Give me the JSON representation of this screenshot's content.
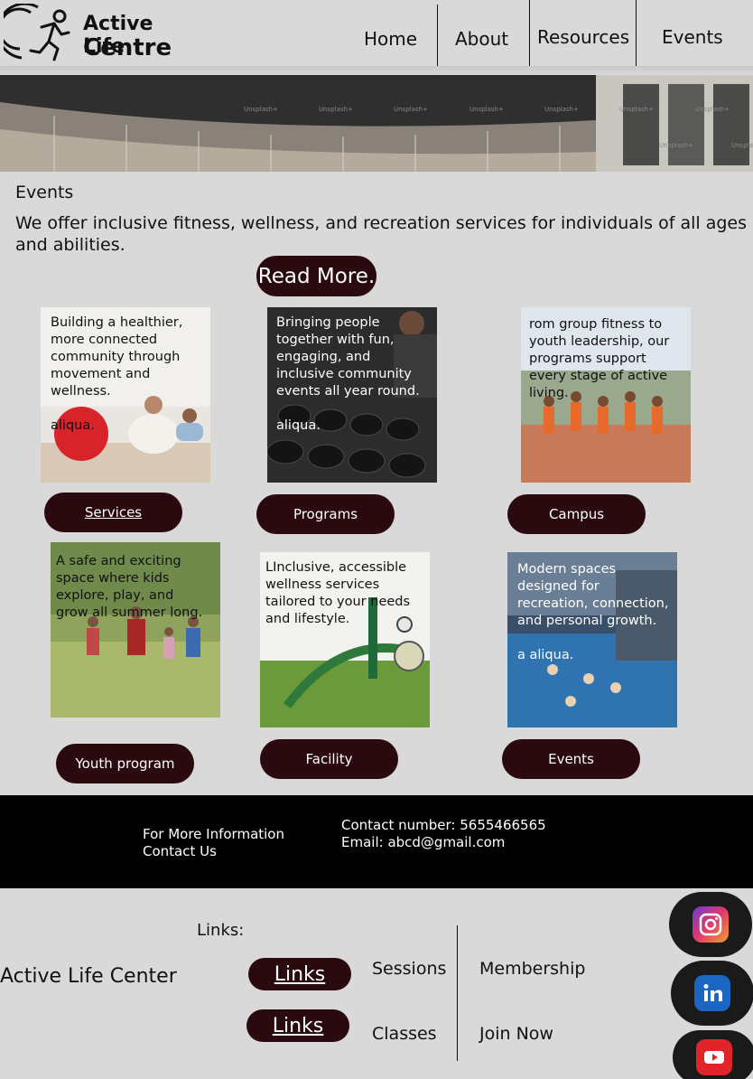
{
  "header": {
    "logo_line1": "Active Life",
    "logo_line2": "Centre",
    "nav": [
      "Home",
      "About",
      "Resources",
      "Events"
    ]
  },
  "hero": {
    "watermark": "Unsplash+"
  },
  "section_title": "Events",
  "intro": "We offer inclusive fitness, wellness, and recreation services for individuals of all ages  and abilities.",
  "read_more": "Read More.",
  "cards": [
    {
      "text": "Building a healthier, more connected community through movement and wellness.",
      "extra": "aliqua.",
      "button": "Services"
    },
    {
      "text": "Bringing people together with fun, engaging, and inclusive community events all year round.",
      "extra": "aliqua.",
      "button": "Programs"
    },
    {
      "text": "rom group fitness to youth leadership, our programs support every stage of active living.",
      "extra": "",
      "button": "Campus"
    },
    {
      "text": "A safe and exciting space where kids explore, play, and grow all summer long.",
      "extra": "",
      "button": "Youth program"
    },
    {
      "text": "LInclusive, accessible wellness services tailored to your needs and lifestyle.",
      "extra": "",
      "button": "Facility"
    },
    {
      "text": "Modern spaces designed for recreation, connection, and personal growth.",
      "extra": "a aliqua.",
      "button": "Events"
    }
  ],
  "footer": {
    "more_info": "For More Information",
    "contact_us": "Contact Us",
    "contact_number": "Contact number: 5655466565",
    "email": "Email: abcd@gmail.com"
  },
  "bottom": {
    "links_title": "Links:",
    "brand": "Active Life Center",
    "link_button_1": "Links",
    "link_button_2": "Links",
    "sessions": "Sessions",
    "classes": "Classes",
    "membership": "Membership",
    "join_now": "Join Now"
  },
  "social": [
    "instagram-icon",
    "linkedin-icon",
    "youtube-icon"
  ],
  "colors": {
    "button": "#2a0a0f",
    "page": "#d9d9d9",
    "footer": "#000000"
  }
}
